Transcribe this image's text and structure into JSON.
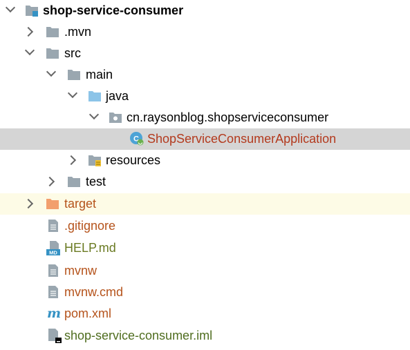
{
  "tree": {
    "root": {
      "label": "shop-service-consumer",
      "icon": "module-folder-icon"
    },
    "mvn": {
      "label": ".mvn",
      "icon": "folder-icon"
    },
    "src": {
      "label": "src",
      "icon": "folder-icon"
    },
    "main": {
      "label": "main",
      "icon": "folder-icon"
    },
    "java": {
      "label": "java",
      "icon": "source-root-folder-icon"
    },
    "package": {
      "label": "cn.raysonblog.shopserviceconsumer",
      "icon": "package-icon"
    },
    "app_class": {
      "label": "ShopServiceConsumerApplication",
      "icon": "spring-boot-class-icon",
      "selected": true
    },
    "resources": {
      "label": "resources",
      "icon": "resources-folder-icon"
    },
    "test": {
      "label": "test",
      "icon": "folder-icon"
    },
    "target": {
      "label": "target",
      "icon": "excluded-folder-icon"
    },
    "gitignore": {
      "label": ".gitignore",
      "icon": "text-file-icon"
    },
    "help": {
      "label": "HELP.md",
      "icon": "markdown-file-icon"
    },
    "mvnw": {
      "label": "mvnw",
      "icon": "text-file-icon"
    },
    "mvnw_cmd": {
      "label": "mvnw.cmd",
      "icon": "text-file-icon"
    },
    "pom": {
      "label": "pom.xml",
      "icon": "maven-icon"
    },
    "iml": {
      "label": "shop-service-consumer.iml",
      "icon": "iml-file-icon"
    }
  },
  "colors": {
    "selection": "#d5d5d5",
    "excluded_bg": "#fdfbe6",
    "folder": "#9aa7b0",
    "source_folder": "#8cc4e8",
    "excluded_folder": "#f29f6d",
    "label_orange": "#b5531b",
    "label_olive": "#6a7a22"
  }
}
